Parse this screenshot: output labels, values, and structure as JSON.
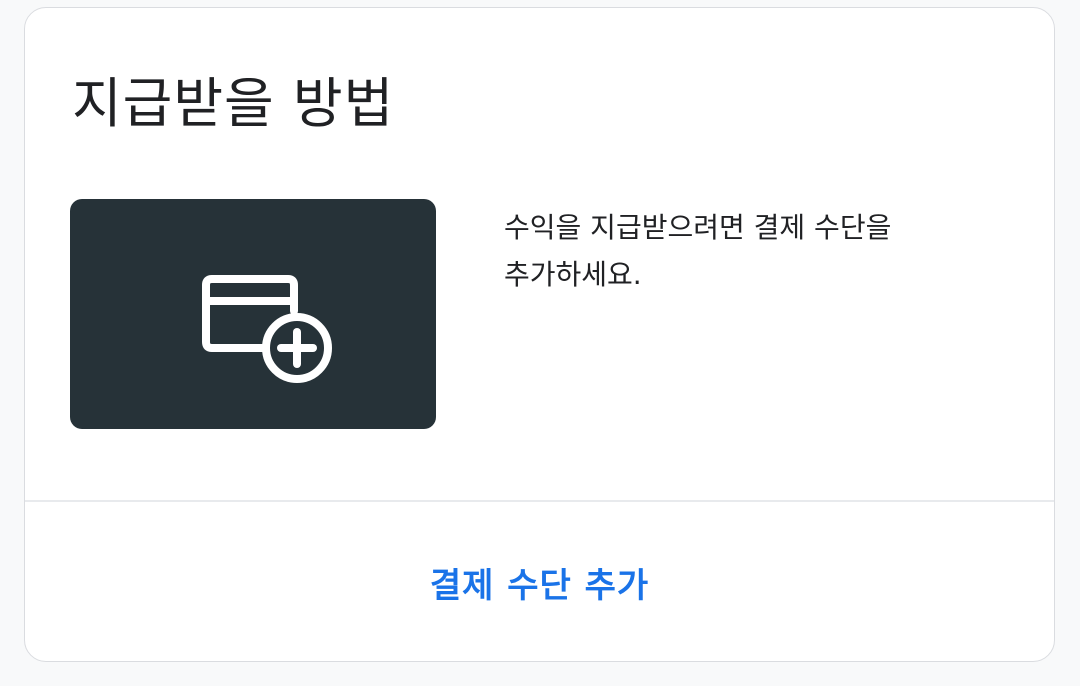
{
  "card": {
    "title": "지급받을 방법",
    "description": "수익을 지급받으려면 결제 수단을 추가하세요.",
    "illustration_icon": "add-card-icon",
    "action_label": "결제 수단 추가"
  },
  "colors": {
    "accent": "#1a73e8",
    "illustration_bg": "#263238",
    "text": "#202124"
  }
}
